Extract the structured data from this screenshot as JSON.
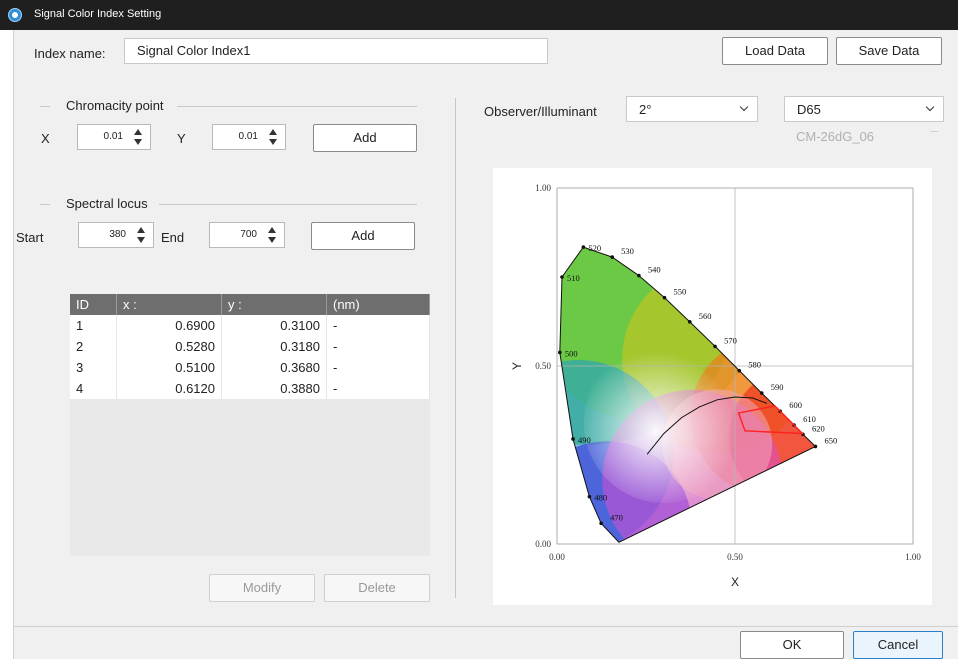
{
  "window": {
    "title": "Signal Color Index Setting"
  },
  "index": {
    "label": "Index name:",
    "value": "Signal Color Index1"
  },
  "buttons": {
    "load": "Load Data",
    "save": "Save Data",
    "add_point": "Add",
    "add_locus": "Add",
    "modify": "Modify",
    "delete": "Delete",
    "ok": "OK",
    "cancel": "Cancel"
  },
  "chromaticity": {
    "title": "Chromacity point",
    "x_label": "X",
    "x_value": "0.01",
    "y_label": "Y",
    "y_value": "0.01"
  },
  "locus": {
    "title": "Spectral  locus",
    "start_label": "Start",
    "start_value": "380",
    "end_label": "End",
    "end_value": "700"
  },
  "table": {
    "headers": [
      "ID",
      "x :",
      "y :",
      "(nm)"
    ],
    "rows": [
      [
        "1",
        "0.6900",
        "0.3100",
        "-"
      ],
      [
        "2",
        "0.5280",
        "0.3180",
        "-"
      ],
      [
        "3",
        "0.5100",
        "0.3680",
        "-"
      ],
      [
        "4",
        "0.6120",
        "0.3880",
        "-"
      ]
    ]
  },
  "observer": {
    "label": "Observer/Illuminant",
    "angle": "2°",
    "illuminant": "D65",
    "instrument": "CM-26dG_06"
  },
  "chart_data": {
    "type": "scatter",
    "xlabel": "X",
    "ylabel": "Y",
    "xlim": [
      0,
      1
    ],
    "ylim": [
      0,
      1
    ],
    "x_ticks": [
      "0.00",
      "0.50",
      "1.00"
    ],
    "y_ticks": [
      "0.00",
      "0.50",
      "1.00"
    ],
    "grid": "crosshair at 0.50",
    "locus_labels": [
      {
        "nm": "470",
        "x": 0.124,
        "y": 0.058
      },
      {
        "nm": "480",
        "x": 0.091,
        "y": 0.133
      },
      {
        "nm": "490",
        "x": 0.045,
        "y": 0.295
      },
      {
        "nm": "500",
        "x": 0.008,
        "y": 0.538
      },
      {
        "nm": "510",
        "x": 0.014,
        "y": 0.75
      },
      {
        "nm": "520",
        "x": 0.074,
        "y": 0.834
      },
      {
        "nm": "530",
        "x": 0.155,
        "y": 0.806
      },
      {
        "nm": "540",
        "x": 0.23,
        "y": 0.754
      },
      {
        "nm": "550",
        "x": 0.302,
        "y": 0.692
      },
      {
        "nm": "560",
        "x": 0.373,
        "y": 0.624
      },
      {
        "nm": "570",
        "x": 0.444,
        "y": 0.555
      },
      {
        "nm": "580",
        "x": 0.512,
        "y": 0.487
      },
      {
        "nm": "590",
        "x": 0.575,
        "y": 0.424
      },
      {
        "nm": "600",
        "x": 0.627,
        "y": 0.373
      },
      {
        "nm": "610",
        "x": 0.666,
        "y": 0.334
      },
      {
        "nm": "620",
        "x": 0.691,
        "y": 0.308
      },
      {
        "nm": "650",
        "x": 0.726,
        "y": 0.274
      }
    ],
    "signal_polygon": [
      [
        0.69,
        0.31
      ],
      [
        0.528,
        0.318
      ],
      [
        0.51,
        0.368
      ],
      [
        0.612,
        0.388
      ]
    ],
    "planckian_locus": [
      [
        0.253,
        0.252
      ],
      [
        0.3,
        0.31
      ],
      [
        0.35,
        0.355
      ],
      [
        0.4,
        0.385
      ],
      [
        0.45,
        0.405
      ],
      [
        0.5,
        0.413
      ],
      [
        0.55,
        0.41
      ],
      [
        0.59,
        0.395
      ]
    ],
    "colors": {
      "polygon": "#ff2020",
      "planckian": "#111111"
    }
  }
}
